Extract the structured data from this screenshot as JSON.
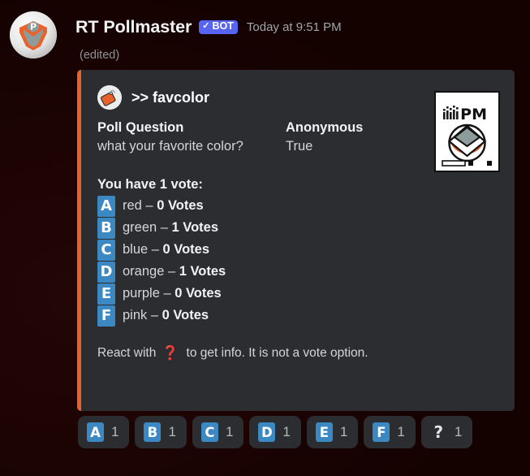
{
  "message": {
    "username": "RT Pollmaster",
    "bot_badge": "BOT",
    "bot_check_icon": "check-icon",
    "timestamp": "Today at 9:51 PM",
    "edited_label": "(edited)",
    "avatar_icon": "pollmaster-avatar"
  },
  "embed": {
    "accent_color": "#e8622a",
    "background_color": "#2b2d31",
    "author": {
      "icon": "label-tag-icon",
      "name": ">> favcolor"
    },
    "fields": [
      {
        "name": "Poll Question",
        "value": "what your favorite color?"
      },
      {
        "name": "Anonymous",
        "value": "True"
      }
    ],
    "description": {
      "title": "You have 1 vote:",
      "options": [
        {
          "letter": "A",
          "text": "red – ",
          "votes": "0 Votes"
        },
        {
          "letter": "B",
          "text": "green – ",
          "votes": "1 Votes"
        },
        {
          "letter": "C",
          "text": "blue – ",
          "votes": "0 Votes"
        },
        {
          "letter": "D",
          "text": "orange – ",
          "votes": "1 Votes"
        },
        {
          "letter": "E",
          "text": "purple – ",
          "votes": "0 Votes"
        },
        {
          "letter": "F",
          "text": "pink – ",
          "votes": "0 Votes"
        }
      ]
    },
    "footer_note": {
      "prefix": "React with",
      "icon": "question-mark-icon",
      "suffix": "to get info. It is not a vote option."
    },
    "thumbnail": {
      "icon": "pollmaster-thumbnail",
      "label": "PM",
      "chart_icon": "bar-chart-icon"
    }
  },
  "reactions": [
    {
      "emoji": "A",
      "type": "letter",
      "count": "1"
    },
    {
      "emoji": "B",
      "type": "letter",
      "count": "1"
    },
    {
      "emoji": "C",
      "type": "letter",
      "count": "1"
    },
    {
      "emoji": "D",
      "type": "letter",
      "count": "1"
    },
    {
      "emoji": "E",
      "type": "letter",
      "count": "1"
    },
    {
      "emoji": "F",
      "type": "letter",
      "count": "1"
    },
    {
      "emoji": "?",
      "type": "question",
      "count": "1"
    }
  ],
  "colors": {
    "badge_blue": "#3b88c3",
    "bot_blurple": "#5865f2",
    "accent_orange": "#e8622a"
  }
}
